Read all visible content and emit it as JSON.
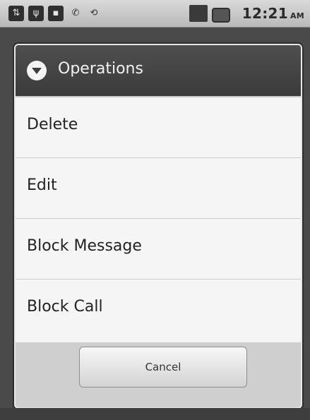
{
  "status_bar": {
    "time": "12:21",
    "ampm": "AM",
    "icons": [
      "usb-icon",
      "usb-debug-icon",
      "sd-card-icon",
      "phone-missed-icon",
      "sync-icon",
      "signal-icon",
      "battery-icon"
    ]
  },
  "dialog": {
    "title": "Operations",
    "icon": "dropdown-circle-icon",
    "items": [
      {
        "label": "Delete"
      },
      {
        "label": "Edit"
      },
      {
        "label": "Block Message"
      },
      {
        "label": "Block Call"
      }
    ],
    "cancel_label": "Cancel"
  },
  "colors": {
    "header_bg": "#444444",
    "item_bg": "#f5f5f5",
    "divider": "#cdcdcd"
  }
}
